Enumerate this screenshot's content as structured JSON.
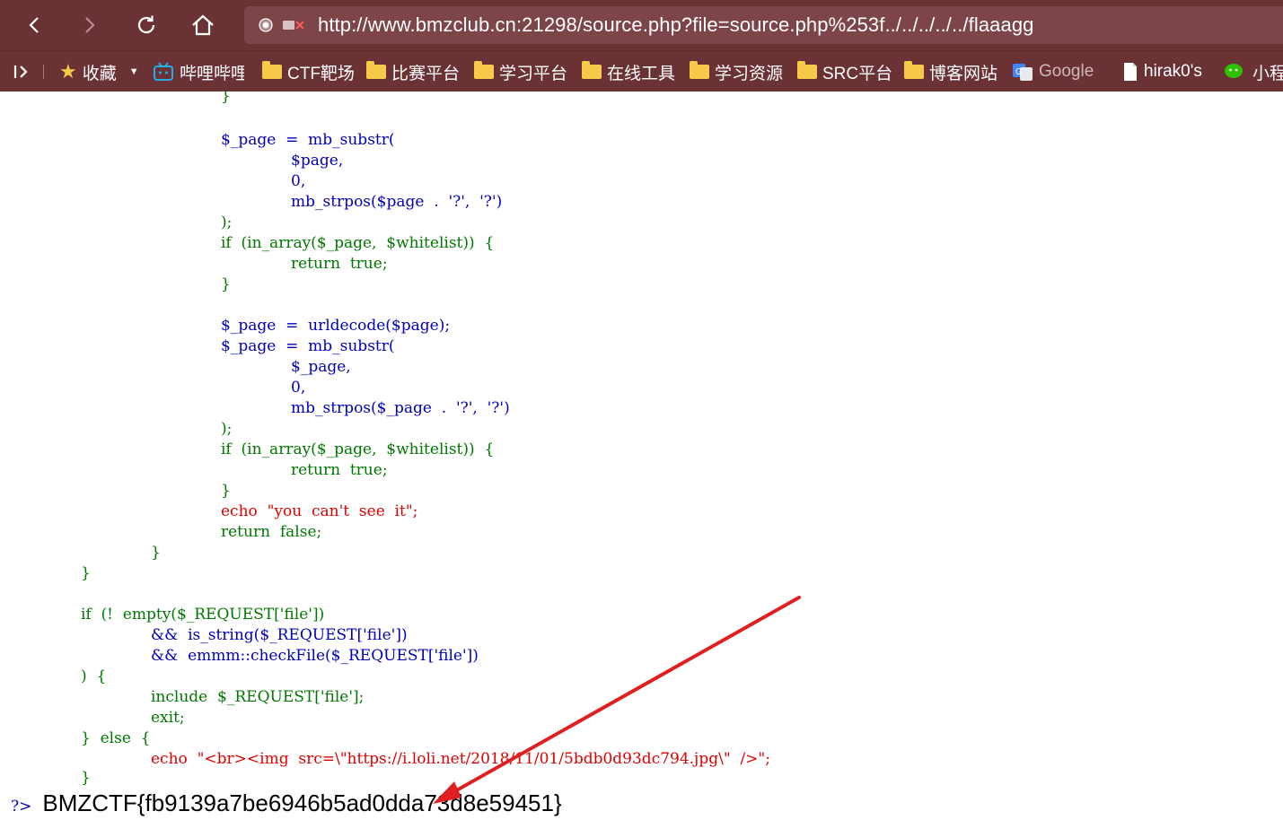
{
  "browser": {
    "url": "http://www.bmzclub.cn:21298/source.php?file=source.php%253f../../../../../flaaagg",
    "bookmarks": [
      {
        "label": "收藏",
        "icon": "star-icon"
      },
      {
        "label": "哔哩哔哩",
        "icon": "bilibili-icon"
      },
      {
        "label": "CTF靶场",
        "icon": "folder-icon"
      },
      {
        "label": "比赛平台",
        "icon": "folder-icon"
      },
      {
        "label": "学习平台",
        "icon": "folder-icon"
      },
      {
        "label": "在线工具",
        "icon": "folder-icon"
      },
      {
        "label": "学习资源",
        "icon": "folder-icon"
      },
      {
        "label": "SRC平台",
        "icon": "folder-icon"
      },
      {
        "label": "博客网站",
        "icon": "folder-icon"
      },
      {
        "label": "Google",
        "icon": "google-translate-icon"
      },
      {
        "label": "hirak0's",
        "icon": "page-icon"
      },
      {
        "label": "小程",
        "icon": "wechat-icon"
      }
    ]
  },
  "code": {
    "lines": [
      "}",
      "$_page  =  mb_substr(",
      "$page,",
      "0,",
      "mb_strpos($page  .  '?',  '?')",
      ");",
      "if  (in_array($_page,  $whitelist))  {",
      "return  true;",
      "}",
      "$_page  =  urldecode($page);",
      "$_page  =  mb_substr(",
      "$_page,",
      "0,",
      "mb_strpos($_page  .  '?',  '?')",
      ");",
      "if  (in_array($_page,  $whitelist))  {",
      "return  true;",
      "}",
      "echo  \"you  can't  see  it\";",
      "return  false;",
      "}",
      "}",
      "if  (!  empty($_REQUEST['file'])",
      "&&  is_string($_REQUEST['file'])",
      "&&  emmm::checkFile($_REQUEST['file'])",
      ")  {",
      "include  $_REQUEST['file'];",
      "exit;",
      "}  else  {",
      "echo  \"<br><img  src=\\\"https://i.loli.net/2018/11/01/5bdb0d93dc794.jpg\\\"  />\";",
      "}"
    ],
    "closing_tag": "?>",
    "flag": "BMZCTF{fb9139a7be6946b5ad0dda73d8e59451}"
  },
  "colors": {
    "chrome": "#6b3236",
    "keyword": "#007700",
    "function": "#0000bb",
    "string": "#dd0000",
    "annotation_arrow": "#e02020"
  }
}
